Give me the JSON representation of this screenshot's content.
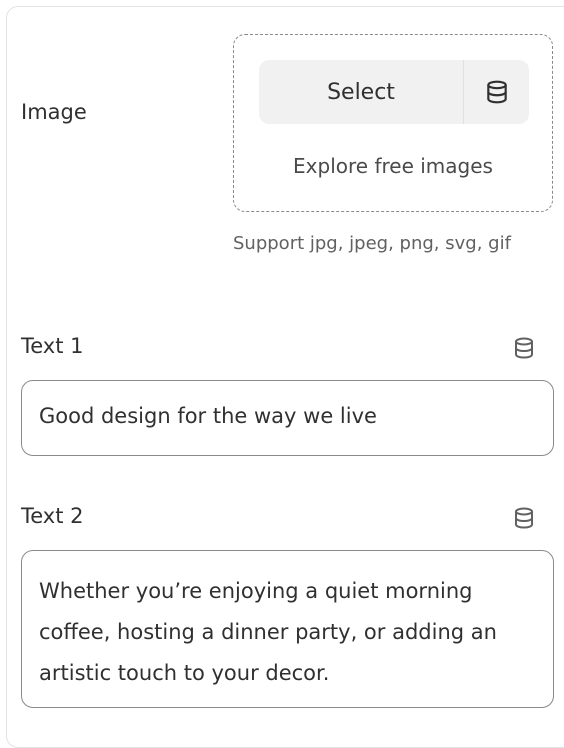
{
  "image_section": {
    "label": "Image",
    "select_label": "Select",
    "source_icon": "database-icon",
    "explore_label": "Explore free images",
    "support_text": "Support jpg, jpeg, png, svg, gif"
  },
  "text1": {
    "label": "Text 1",
    "icon": "database-icon",
    "value": "Good design for the way we live"
  },
  "text2": {
    "label": "Text 2",
    "icon": "database-icon",
    "value": "Whether you’re enjoying a quiet morning coffee, hosting a dinner party, or adding an artistic touch to your decor."
  }
}
